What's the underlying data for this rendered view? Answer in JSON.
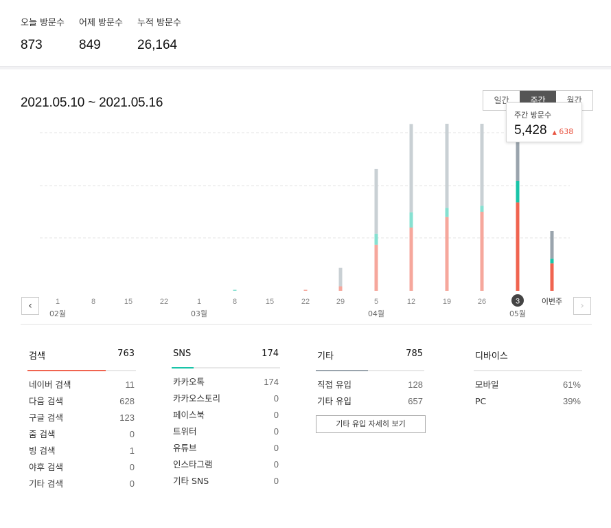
{
  "top_stats": [
    {
      "label": "오늘 방문수",
      "value": "873"
    },
    {
      "label": "어제 방문수",
      "value": "849"
    },
    {
      "label": "누적 방문수",
      "value": "26,164"
    }
  ],
  "period": {
    "range": "2021.05.10 ~ 2021.05.16"
  },
  "view_toggle": {
    "daily": "일간",
    "weekly": "주간",
    "monthly": "월간",
    "active": "주간"
  },
  "tooltip": {
    "label": "주간 방문수",
    "value": "5,428",
    "delta": "638",
    "delta_icon": "triangle-up-icon"
  },
  "nav": {
    "prev_icon": "chevron-left-icon",
    "next_icon": "chevron-right-icon"
  },
  "colors": {
    "search": "#f06450",
    "sns": "#19c4a8",
    "etc": "#9aa4ad",
    "search_light": "#f6a79c",
    "sns_light": "#86e0d1",
    "etc_light": "#c9d0d4"
  },
  "chart_data": {
    "type": "bar",
    "stacked": true,
    "categories": [
      "1",
      "8",
      "15",
      "22",
      "1",
      "8",
      "15",
      "22",
      "29",
      "5",
      "12",
      "19",
      "26",
      "3",
      "이번주"
    ],
    "month_labels": [
      {
        "index": 0,
        "label": "02월"
      },
      {
        "index": 4,
        "label": "03월"
      },
      {
        "index": 9,
        "label": "04월"
      },
      {
        "index": 13,
        "label": "05월"
      }
    ],
    "selected_index": 13,
    "series": [
      {
        "values": [
          0,
          0,
          0,
          0,
          0,
          0,
          0,
          10,
          170,
          1750,
          2400,
          2800,
          3000,
          3354,
          1040
        ]
      },
      {
        "values": [
          0,
          0,
          0,
          0,
          0,
          15,
          0,
          0,
          0,
          420,
          580,
          350,
          230,
          820,
          180
        ]
      },
      {
        "values": [
          0,
          0,
          0,
          0,
          0,
          0,
          0,
          0,
          700,
          2450,
          3350,
          3500,
          3200,
          3254,
          1050
        ]
      }
    ],
    "ylim": [
      0,
      6000
    ],
    "grid": true
  },
  "columns": [
    {
      "title": "검색",
      "total": "763",
      "accent": "#f06450",
      "accent_frac": 0.72,
      "rows": [
        {
          "label": "네이버 검색",
          "value": "11"
        },
        {
          "label": "다음 검색",
          "value": "628"
        },
        {
          "label": "구글 검색",
          "value": "123"
        },
        {
          "label": "줌 검색",
          "value": "0"
        },
        {
          "label": "빙 검색",
          "value": "1"
        },
        {
          "label": "야후 검색",
          "value": "0"
        },
        {
          "label": "기타 검색",
          "value": "0"
        }
      ]
    },
    {
      "title": "SNS",
      "total": "174",
      "accent": "#19c4a8",
      "accent_frac": 0.2,
      "rows": [
        {
          "label": "카카오톡",
          "value": "174"
        },
        {
          "label": "카카오스토리",
          "value": "0"
        },
        {
          "label": "페이스북",
          "value": "0"
        },
        {
          "label": "트위터",
          "value": "0"
        },
        {
          "label": "유튜브",
          "value": "0"
        },
        {
          "label": "인스타그램",
          "value": "0"
        },
        {
          "label": "기타 SNS",
          "value": "0"
        }
      ]
    },
    {
      "title": "기타",
      "total": "785",
      "accent": "#9aa4ad",
      "accent_frac": 0.48,
      "rows": [
        {
          "label": "직접 유입",
          "value": "128"
        },
        {
          "label": "기타 유입",
          "value": "657"
        }
      ],
      "button": "기타 유입 자세히 보기"
    },
    {
      "title": "디바이스",
      "total": "",
      "accent": "#e8e8e8",
      "accent_frac": 0,
      "rows": [
        {
          "label": "모바일",
          "value": "61%"
        },
        {
          "label": "PC",
          "value": "39%"
        }
      ]
    }
  ]
}
